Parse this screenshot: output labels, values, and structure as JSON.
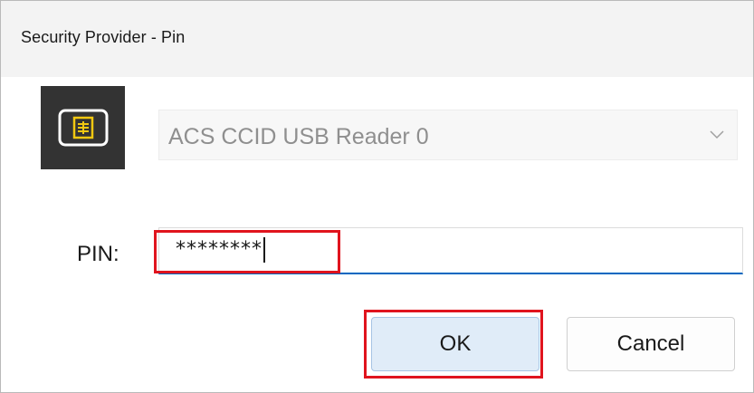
{
  "window": {
    "title": "Security Provider - Pin"
  },
  "reader": {
    "icon": "smartcard-reader-icon",
    "selected": "ACS CCID USB Reader 0",
    "chevron_icon": "chevron-down-icon"
  },
  "pin": {
    "label": "PIN:",
    "value": "********"
  },
  "buttons": {
    "ok_label": "OK",
    "cancel_label": "Cancel"
  },
  "colors": {
    "accent": "#0067c0",
    "highlight": "#e0141e",
    "icon_tile": "#333333",
    "icon_accent": "#f2c811"
  }
}
